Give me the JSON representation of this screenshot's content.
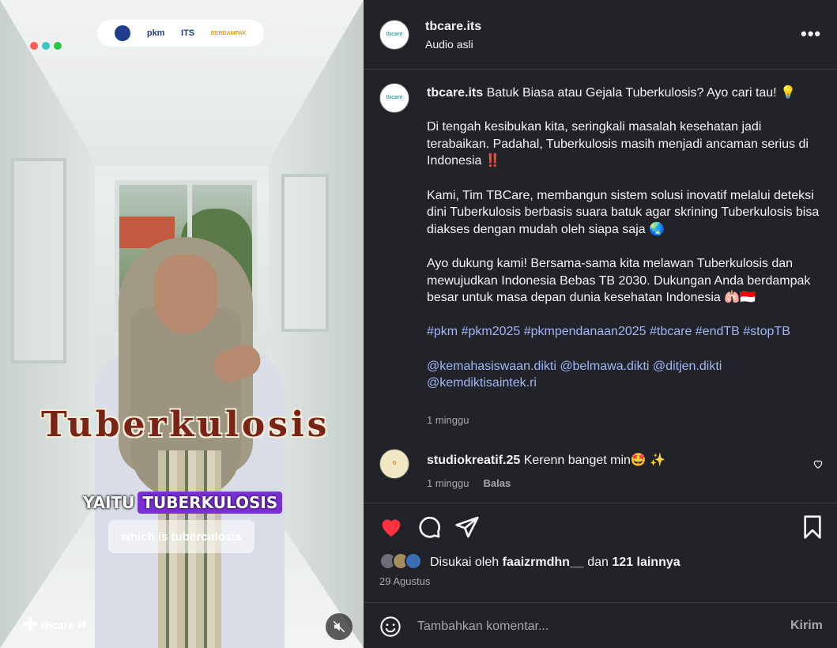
{
  "video": {
    "logos": [
      "pkm",
      "ITS",
      "BERDAMPAK"
    ],
    "title_overlay": "Tuberkulosis",
    "caption_word_1": "YAITU",
    "caption_word_2": "TUBERKULOSIS",
    "subtitle": "which is tuberculosis",
    "watermark": "tbcare",
    "mute_icon": "speaker-muted-icon"
  },
  "header": {
    "username": "tbcare.its",
    "audio": "Audio asli",
    "more_label": "•••",
    "avatar_text": "tbcare"
  },
  "post": {
    "author": "tbcare.its",
    "headline": "Batuk Biasa atau Gejala Tuberkulosis? Ayo cari tau! 💡",
    "para_1": "Di tengah kesibukan kita, seringkali masalah kesehatan jadi terabaikan. Padahal, Tuberkulosis masih menjadi ancaman serius di Indonesia ‼️",
    "para_2": "Kami, Tim TBCare, membangun sistem solusi inovatif melalui deteksi dini Tuberkulosis berbasis suara batuk agar skrining Tuberkulosis bisa diakses dengan mudah oleh siapa saja 🌏",
    "para_3": "Ayo dukung kami! Bersama-sama kita melawan Tuberkulosis dan mewujudkan Indonesia Bebas TB 2030. Dukungan Anda berdampak besar untuk masa depan dunia kesehatan Indonesia 🫁🇮🇩",
    "hashtags": "#pkm #pkm2025 #pkmpendanaan2025 #tbcare #endTB #stopTB",
    "mentions": "@kemahasiswaan.dikti @belmawa.dikti @ditjen.dikti @kemdiktisaintek.ri",
    "time": "1 minggu"
  },
  "comment": {
    "author": "studiokreatif.25",
    "text": "Kerenn banget min🤩 ✨",
    "time": "1 minggu",
    "reply_label": "Balas"
  },
  "actions": {
    "liked_prefix": "Disukai oleh",
    "liked_user": "faaizrmdhn__",
    "liked_and": "dan",
    "liked_count": "121 lainnya",
    "date": "29 Agustus",
    "like_color": "#ff3040"
  },
  "comment_box": {
    "placeholder": "Tambahkan komentar...",
    "post_label": "Kirim"
  }
}
